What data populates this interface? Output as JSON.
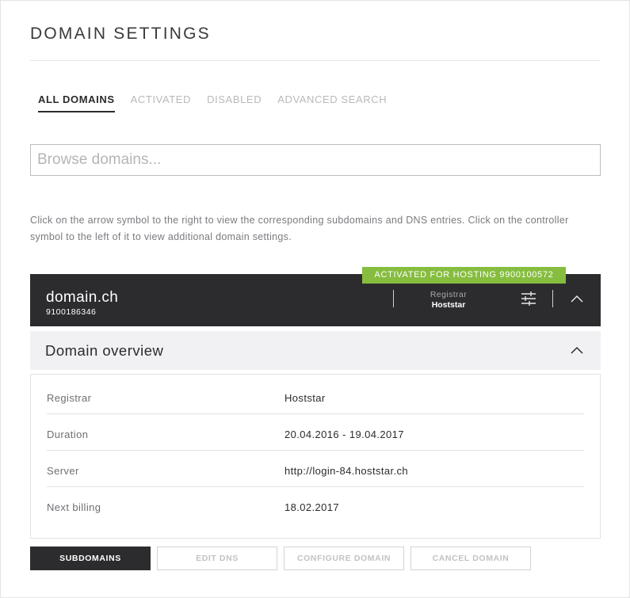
{
  "page": {
    "title": "DOMAIN SETTINGS"
  },
  "tabs": [
    {
      "label": "ALL DOMAINS",
      "active": true
    },
    {
      "label": "ACTIVATED",
      "active": false
    },
    {
      "label": "DISABLED",
      "active": false
    },
    {
      "label": "ADVANCED SEARCH",
      "active": false
    }
  ],
  "search": {
    "placeholder": "Browse domains...",
    "value": ""
  },
  "hint": "Click on the arrow symbol to the right to view the corresponding subdomains and DNS entries. Click on the controller symbol to the left of it to view additional domain settings.",
  "domain": {
    "name": "domain.ch",
    "number": "9100186346",
    "badge": "ACTIVATED FOR HOSTING 9900100572",
    "registrar_label": "Registrar",
    "registrar_value": "Hoststar",
    "icons": {
      "settings": "sliders-icon",
      "collapse": "chevron-up-icon"
    }
  },
  "overview": {
    "title": "Domain overview",
    "rows": [
      {
        "label": "Registrar",
        "value": "Hoststar"
      },
      {
        "label": "Duration",
        "value": "20.04.2016 - 19.04.2017"
      },
      {
        "label": "Server",
        "value": "http://login-84.hoststar.ch"
      },
      {
        "label": "Next billing",
        "value": "18.02.2017"
      }
    ]
  },
  "actions": {
    "subdomains": "SUBDOMAINS",
    "edit_dns": "EDIT DNS",
    "configure_domain": "CONFIGURE DOMAIN",
    "cancel_domain": "CANCEL DOMAIN"
  },
  "colors": {
    "dark": "#2c2c2e",
    "badge": "#86bd3f",
    "muted": "#b9b9bd",
    "panel": "#f1f1f3"
  }
}
